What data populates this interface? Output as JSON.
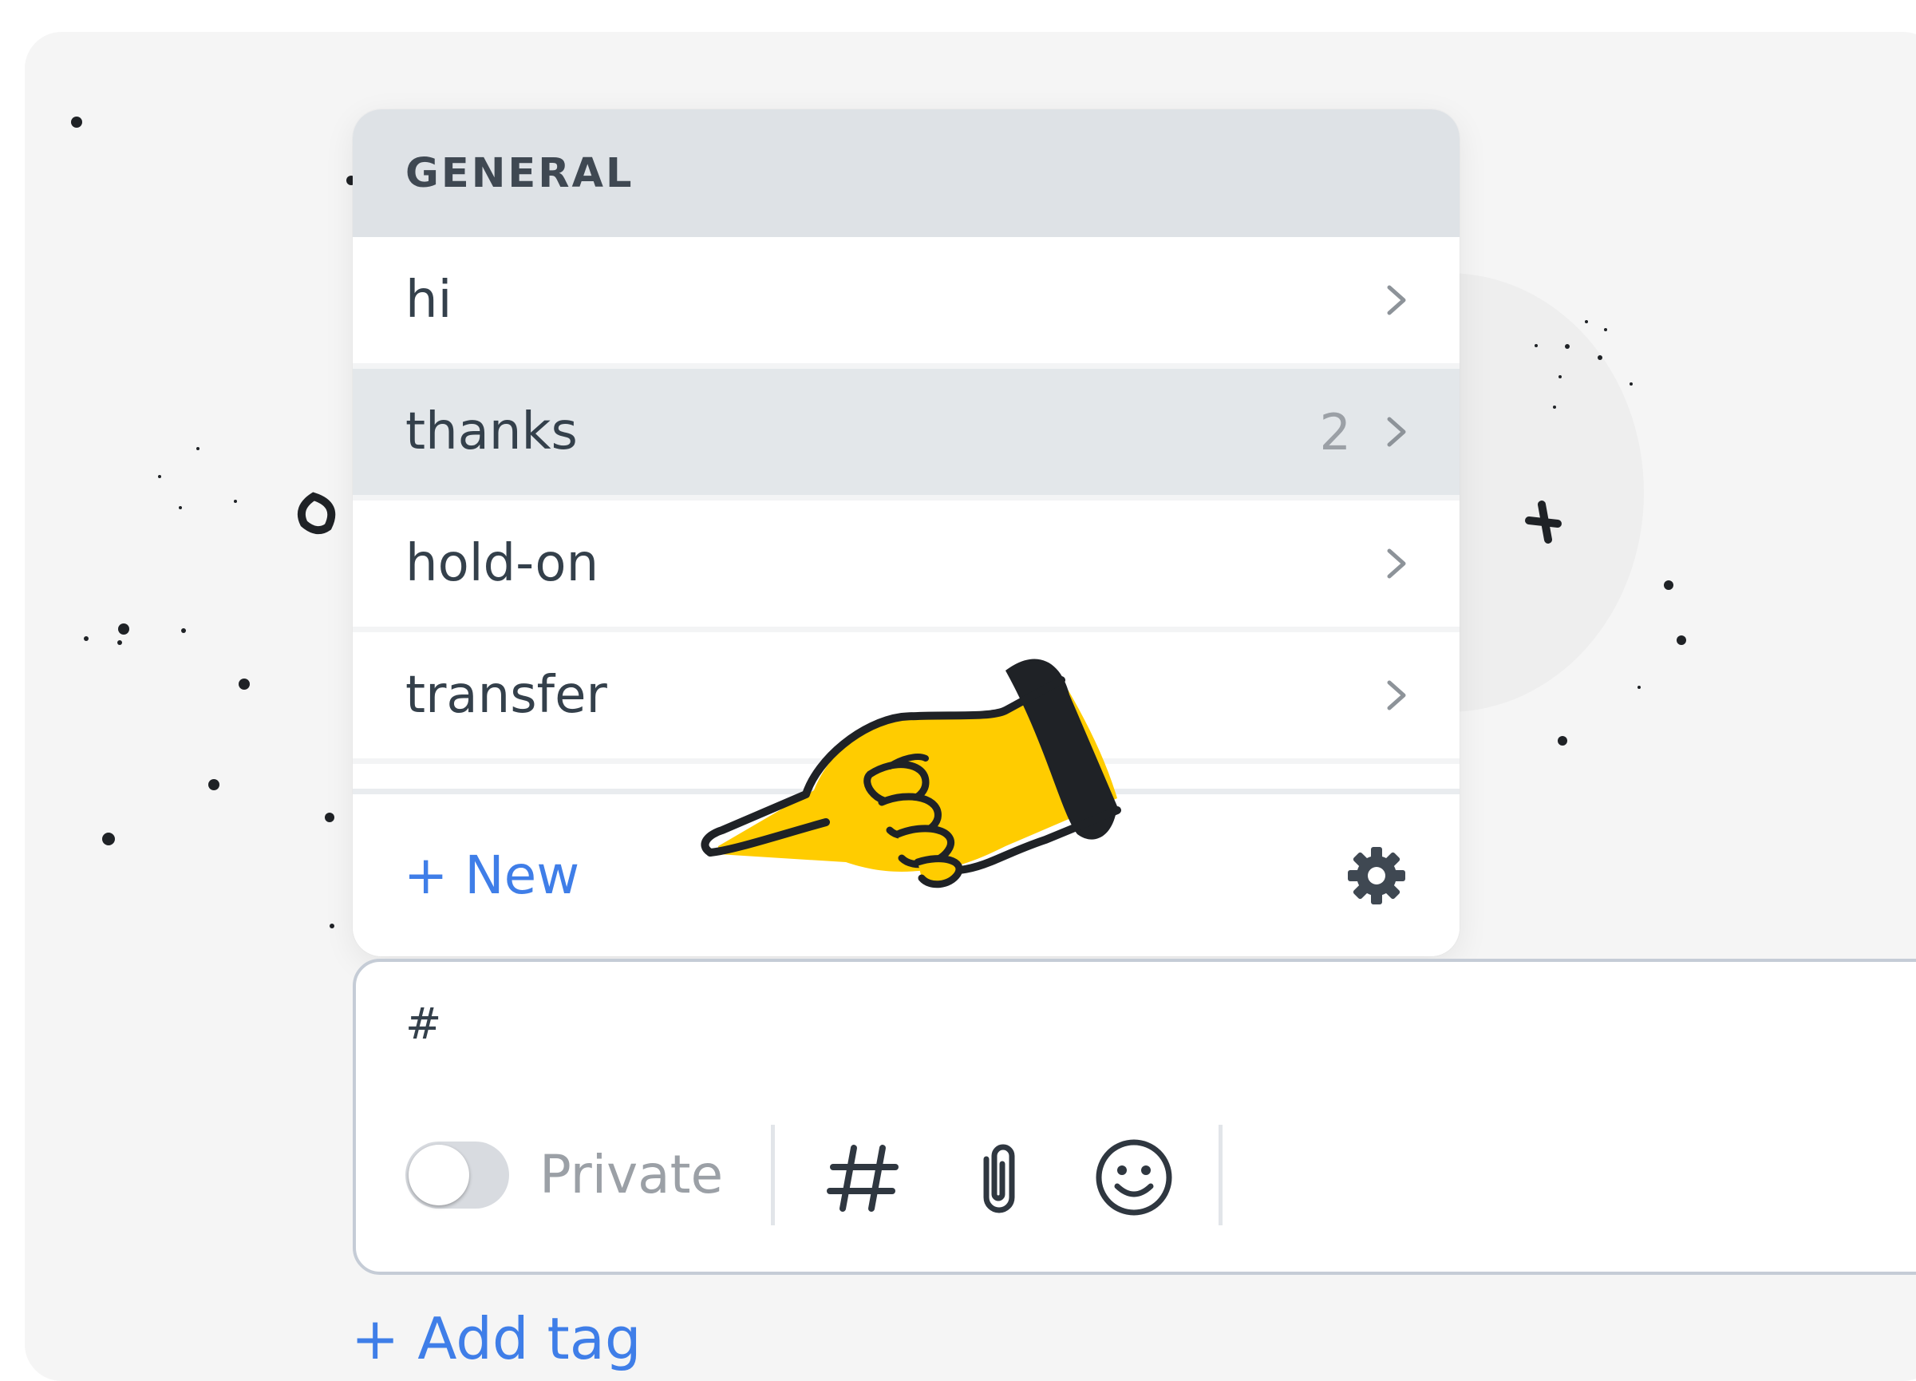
{
  "dropdown": {
    "header": "GENERAL",
    "items": [
      {
        "label": "hi",
        "count": ""
      },
      {
        "label": "thanks",
        "count": "2"
      },
      {
        "label": "hold-on",
        "count": ""
      },
      {
        "label": "transfer",
        "count": ""
      }
    ],
    "new_label": "+ New"
  },
  "composer": {
    "input_text": "#",
    "private_label": "Private"
  },
  "add_tag_label": "+ Add tag",
  "colors": {
    "accent": "#3f7ee8",
    "header_bg": "#dee2e6",
    "active_row_bg": "#e3e7ea",
    "hand_yellow": "#ffcc00"
  },
  "icons": [
    "chevron-right-icon",
    "gear-icon",
    "hashtag-icon",
    "paperclip-icon",
    "smiley-icon",
    "pointing-hand-icon"
  ]
}
